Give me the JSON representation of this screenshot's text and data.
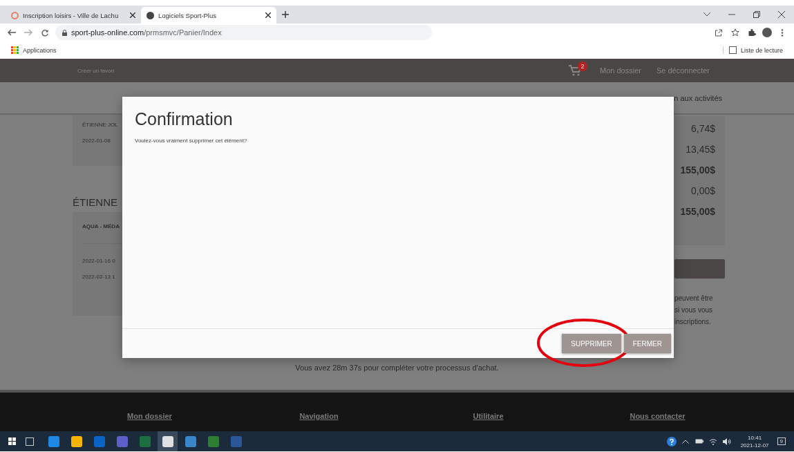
{
  "browser": {
    "tabs": [
      {
        "title": "Inscription loisirs - Ville de Lachu",
        "selected": false
      },
      {
        "title": "Logiciels Sport-Plus",
        "selected": true
      }
    ],
    "url_host": "sport-plus-online.com",
    "url_path": "/prmsmvc/Panier/Index",
    "bookmark": "Applications",
    "reading_list": "Liste de lecture"
  },
  "site_nav": {
    "favorite": "Créer un favori",
    "cart_count": "2",
    "links": [
      "Mon dossier",
      "Se déconnecter"
    ]
  },
  "page": {
    "subheader": "n aux activités",
    "left": {
      "member": "ÉTIENNE JOL",
      "member_date": "2022-01-08",
      "heading": "ÉTIENNE",
      "activity": "AQUA - MÉDA",
      "dates": [
        "2022-01-16 0",
        "2022-02-13 1"
      ]
    },
    "amounts": [
      {
        "text": "6,74$",
        "bold": false
      },
      {
        "text": "13,45$",
        "bold": false
      },
      {
        "text": "155,00$",
        "bold": true
      },
      {
        "text": "0,00$",
        "bold": false
      },
      {
        "text": "155,00$",
        "bold": true
      }
    ],
    "note_lines": [
      "peuvent être",
      "si vous vous",
      "inscriptions."
    ],
    "timer": "Vous avez 28m 37s pour compléter votre processus d'achat."
  },
  "modal": {
    "title": "Confirmation",
    "message": "Voulez-vous vraiment supprimer cet élément?",
    "buttons": [
      {
        "label": "SUPPRIMER",
        "circled": true
      },
      {
        "label": "FERMER",
        "circled": false
      }
    ]
  },
  "footer": {
    "headings": [
      "Mon dossier",
      "Navigation",
      "Utilitaire",
      "Nous contacter"
    ]
  },
  "taskbar": {
    "time": "10:41",
    "date": "2021-12-07",
    "notifications": "9"
  }
}
